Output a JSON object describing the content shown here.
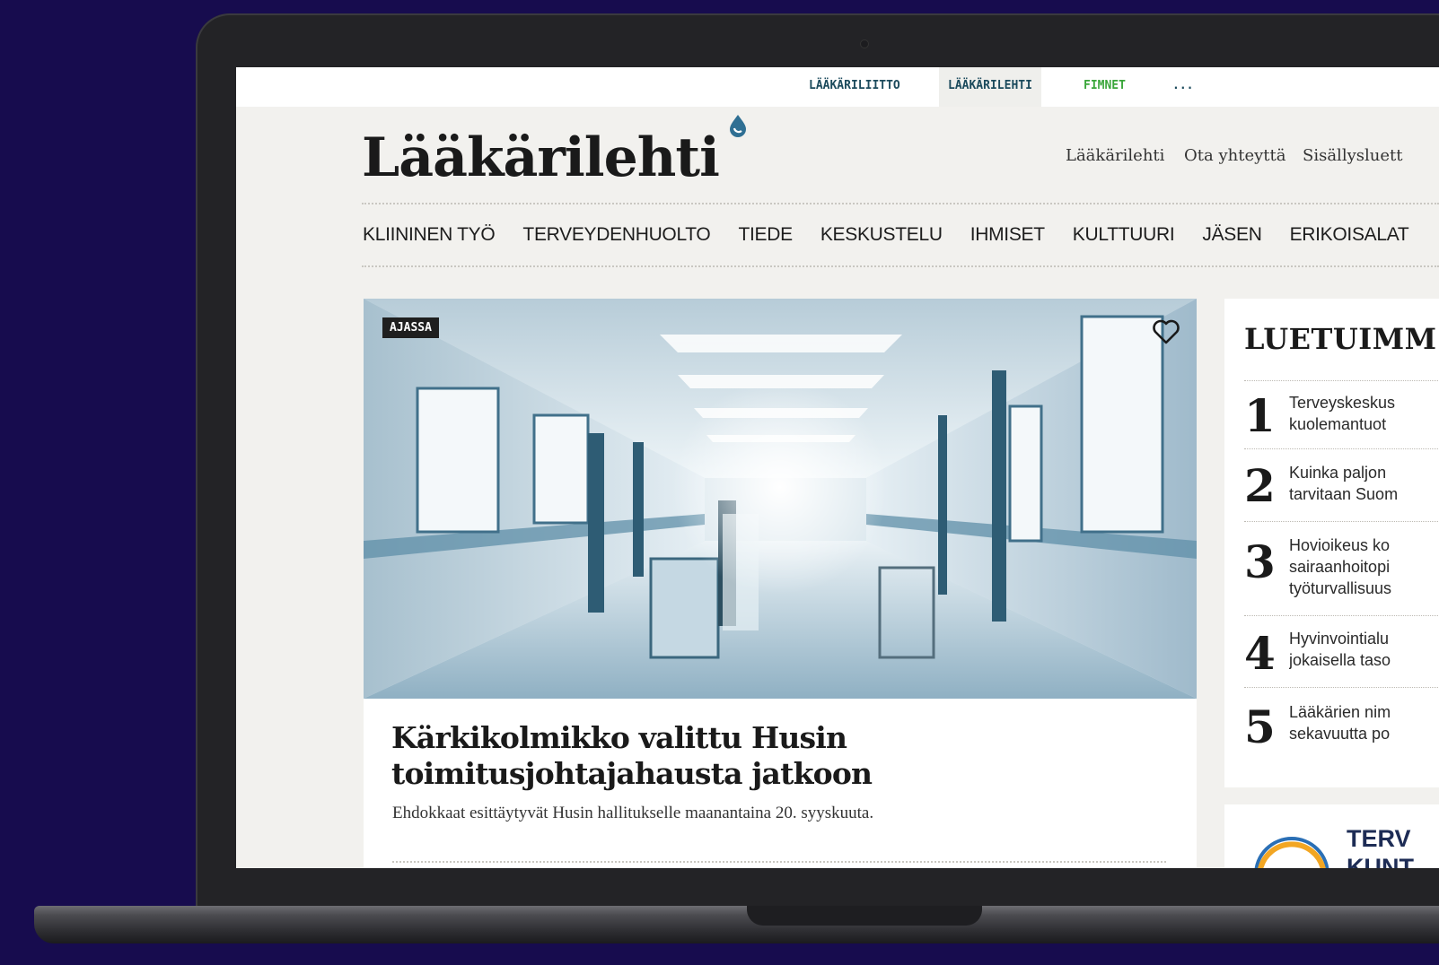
{
  "top_links": [
    "LÄÄKÄRILIITTO",
    "LÄÄKÄRILEHTI",
    "FIMNET",
    "..."
  ],
  "brand": {
    "logo": "Lääkärilehti"
  },
  "utility_links": [
    "Lääkärilehti",
    "Ota yhteyttä",
    "Sisällysluett"
  ],
  "nav_items": [
    "KLIININEN TYÖ",
    "TERVEYDENHUOLTO",
    "TIEDE",
    "KESKUSTELU",
    "IHMISET",
    "KULTTUURI",
    "JÄSEN",
    "ERIKOISALAT"
  ],
  "featured": {
    "tag": "AJASSA",
    "headline": "Kärkikolmikko valittu Husin toimitusjohtajahausta jatkoon",
    "lead": "Ehdokkaat esittäytyvät Husin hallitukselle maanantaina 20. syyskuuta."
  },
  "most_read": {
    "title": "LUETUIMM",
    "items": [
      {
        "num": "1",
        "text": "Terveyskeskus\nkuolemantuot"
      },
      {
        "num": "2",
        "text": "Kuinka paljon\ntarvitaan Suom"
      },
      {
        "num": "3",
        "text": "Hovioikeus ko\nsairaanhoitopi\ntyöturvallisuus"
      },
      {
        "num": "4",
        "text": "Hyvinvointialu\njokaisella taso"
      },
      {
        "num": "5",
        "text": "Lääkärien nim\nsekavuutta po"
      }
    ]
  },
  "ad": {
    "text": "TERV\nKUNT"
  },
  "colors": {
    "background": "#170c4e",
    "screen_bg": "#f2f1ee",
    "link_dark": "#1b4a5c",
    "link_green": "#3aa63a",
    "ad_blue": "#1d2c55"
  }
}
